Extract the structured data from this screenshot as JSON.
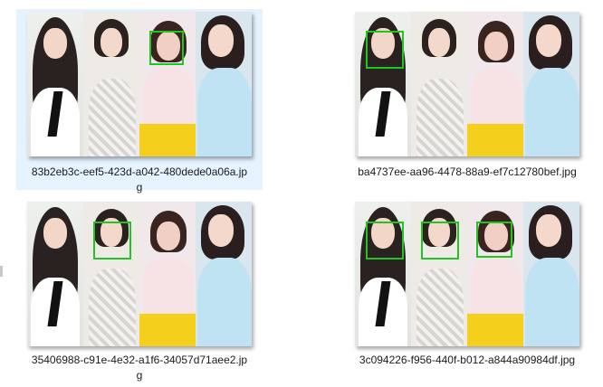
{
  "files": [
    {
      "name": "83b2eb3c-eef5-423d-a042-480dede0a06a.jpg",
      "selected": true,
      "faces_detected": [
        3
      ]
    },
    {
      "name": "ba4737ee-aa96-4478-88a9-ef7c12780bef.jpg",
      "selected": false,
      "faces_detected": [
        1
      ]
    },
    {
      "name": "35406988-c91e-4e32-a1f6-34057d71aee2.jpg",
      "selected": false,
      "faces_detected": [
        2
      ]
    },
    {
      "name": "3c094226-f956-440f-b012-a844a90984df.jpg",
      "selected": false,
      "faces_detected": [
        1,
        2,
        3
      ]
    }
  ],
  "colors": {
    "selection": "#e5f3ff",
    "face_box": "#21c521"
  }
}
